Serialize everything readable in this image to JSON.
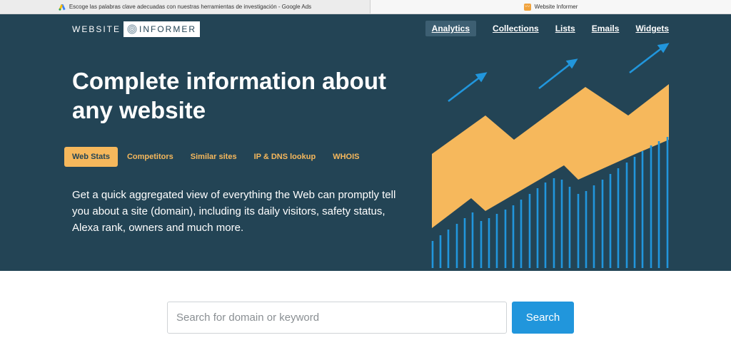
{
  "browser": {
    "tabs": [
      {
        "title": "Escoge las palabras clave adecuadas con nuestras herramientas de investigación - Google Ads",
        "icon": "google-ads-icon"
      },
      {
        "title": "Website Informer",
        "icon": "website-informer-icon"
      }
    ]
  },
  "logo": {
    "word1": "WEBSITE",
    "word2": "INFORMER"
  },
  "nav": {
    "items": [
      "Analytics",
      "Collections",
      "Lists",
      "Emails",
      "Widgets"
    ],
    "active": "Analytics"
  },
  "hero": {
    "headline_line1": "Complete information about",
    "headline_line2": "any website",
    "tabs": [
      "Web Stats",
      "Competitors",
      "Similar sites",
      "IP & DNS lookup",
      "WHOIS"
    ],
    "active_tab": "Web Stats",
    "description": "Get a quick aggregated view of everything the Web can promptly tell you about a site (domain), including its daily visitors, safety status, Alexa rank, owners and much more."
  },
  "search": {
    "placeholder": "Search for domain or keyword",
    "value": "",
    "button_label": "Search"
  },
  "colors": {
    "hero_bg": "#234455",
    "accent_orange": "#f6b85c",
    "accent_blue": "#2196dc",
    "active_nav_bg": "#3d5f72"
  }
}
